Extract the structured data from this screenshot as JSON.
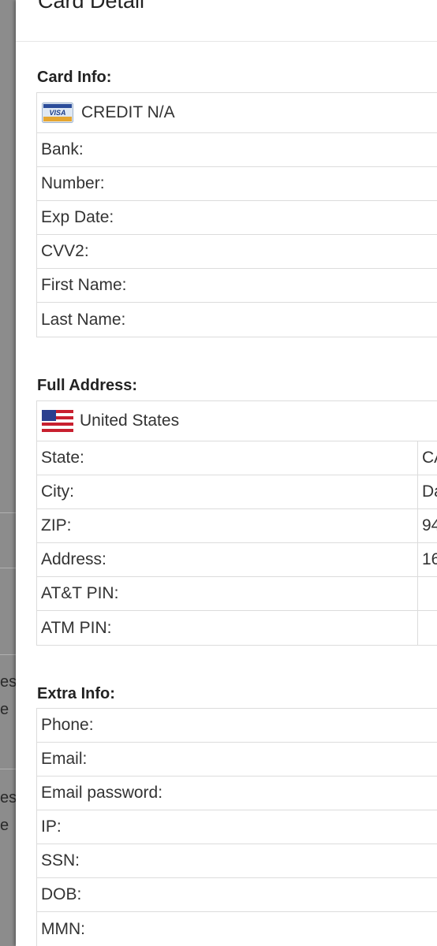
{
  "modal": {
    "title": "Card Detail"
  },
  "card_info": {
    "title": "Card Info:",
    "card_type": "CREDIT N/A",
    "card_brand_icon": "visa-card-icon",
    "rows": [
      "Bank:",
      "Number:",
      "Exp Date:",
      "CVV2:",
      "First Name:",
      "Last Name:"
    ]
  },
  "full_address": {
    "title": "Full Address:",
    "country": "United States",
    "country_flag_icon": "us-flag-icon",
    "rows": [
      {
        "label": "State:",
        "value": "CA"
      },
      {
        "label": "City:",
        "value": "Da"
      },
      {
        "label": "ZIP:",
        "value": "94"
      },
      {
        "label": "Address:",
        "value": "16"
      },
      {
        "label": "AT&T PIN:",
        "value": ""
      },
      {
        "label": "ATM PIN:",
        "value": ""
      }
    ]
  },
  "extra_info": {
    "title": "Extra Info:",
    "rows": [
      "Phone:",
      "Email:",
      "Email password:",
      "IP:",
      "SSN:",
      "DOB:",
      "MMN:"
    ]
  },
  "background_text": [
    "es",
    "e",
    "es",
    "e"
  ]
}
